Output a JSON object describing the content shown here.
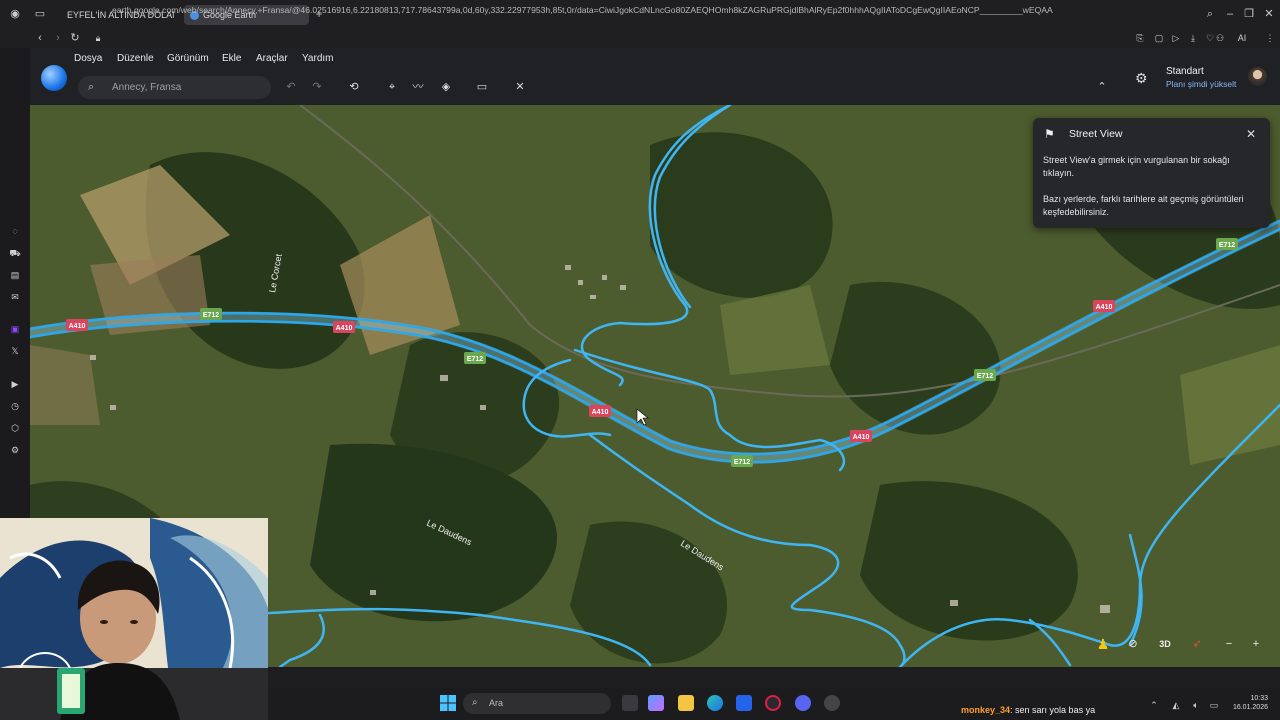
{
  "browser": {
    "tabs": [
      {
        "label": "EYFEL'İN ALTINDA DOLAN",
        "active": false
      },
      {
        "label": "Google Earth",
        "active": true
      }
    ],
    "url": "earth.google.com/web/search/Annecy,+Fransa/@46.02516916,6.22180813,717.78643799a,0d,60y,332.22977953h,85t,0r/data=CiwiJgokCdNLncGo80ZAEQHOmh8kZAGRuPRGjdlBhAlRyEp2f0hhhAQgIIAToDCgEwQgIIAEoNCP_________wEQAA",
    "ai_label": "AI"
  },
  "earth": {
    "menu": [
      "Dosya",
      "Düzenle",
      "Görünüm",
      "Ekle",
      "Araçlar",
      "Yardım"
    ],
    "search_placeholder": "Annecy, Fransa",
    "plan_title": "Standart",
    "plan_subtitle": "Planı şimdi yükselt",
    "street_view": {
      "title": "Street View",
      "text1": "Street View'a girmek için vurgulanan bir sokağı tıklayın.",
      "text2": "Bazı yerlerde, farklı tarihlere ait geçmiş görüntüleri keşfedebilirsiniz."
    },
    "road_labels": {
      "a410": "A410",
      "e712": "E712",
      "le_corcet": "Le Corcet",
      "le_daudens": "Le Daudens"
    },
    "controls": {
      "mode_3d": "3D",
      "zoom_out": "−",
      "zoom_in": "+"
    }
  },
  "taskbar": {
    "search_label": "Ara",
    "chat_user": "monkey_34",
    "chat_message": ": sen sarı yola bas ya",
    "time": "10:33",
    "date": "16.01.2026"
  }
}
